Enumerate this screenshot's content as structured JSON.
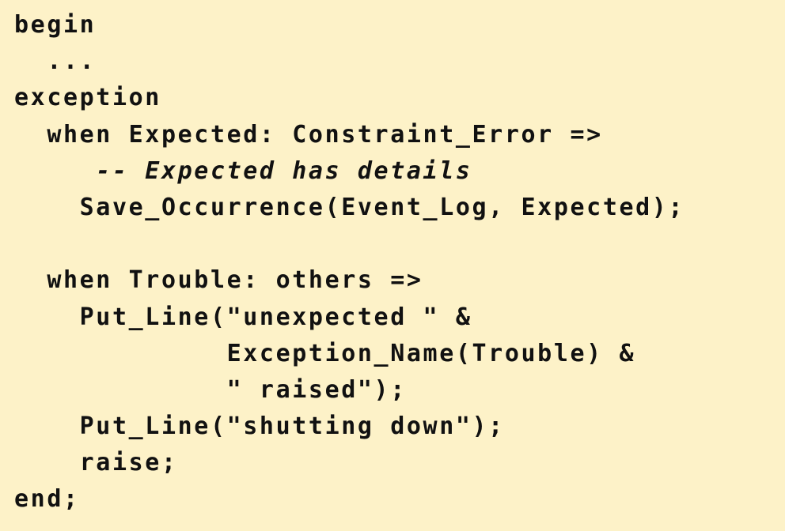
{
  "code_lines": [
    {
      "text": "begin",
      "style": "code"
    },
    {
      "text": "  ...",
      "style": "code"
    },
    {
      "text": "exception",
      "style": "code"
    },
    {
      "text": "  when Expected: Constraint_Error =>",
      "style": "code"
    },
    {
      "text": "     -- Expected has details",
      "style": "comment"
    },
    {
      "text": "    Save_Occurrence(Event_Log, Expected);",
      "style": "code"
    },
    {
      "text": "",
      "style": "blank"
    },
    {
      "text": "  when Trouble: others =>",
      "style": "code"
    },
    {
      "text": "    Put_Line(\"unexpected \" &",
      "style": "code"
    },
    {
      "text": "             Exception_Name(Trouble) &",
      "style": "code"
    },
    {
      "text": "             \" raised\");",
      "style": "code"
    },
    {
      "text": "    Put_Line(\"shutting down\");",
      "style": "code"
    },
    {
      "text": "    raise;",
      "style": "code"
    },
    {
      "text": "end;",
      "style": "code"
    }
  ]
}
